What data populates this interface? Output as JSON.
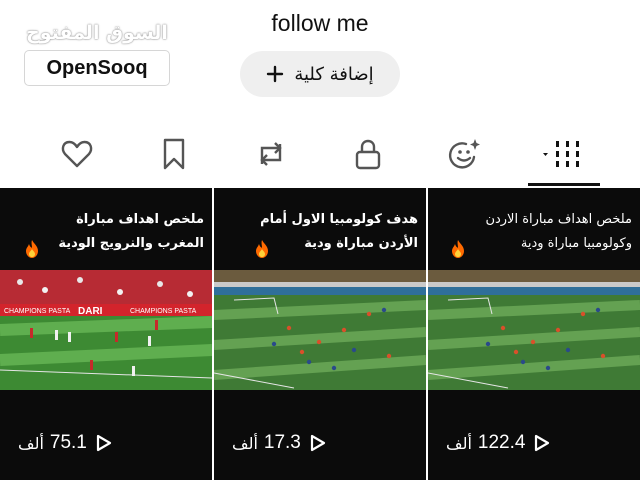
{
  "profile": {
    "bio": "follow me",
    "add_button_label": "إضافة كلية"
  },
  "watermark": {
    "arabic": "السوق المفتوح",
    "latin": "OpenSooq"
  },
  "tabs": [
    {
      "name": "reels-grid-tab",
      "icon": "reels-grid-icon",
      "active": true
    },
    {
      "name": "collab-tab",
      "icon": "smiley-sparkle-icon"
    },
    {
      "name": "private-tab",
      "icon": "lock-icon"
    },
    {
      "name": "reposts-tab",
      "icon": "repost-icon"
    },
    {
      "name": "saved-tab",
      "icon": "bookmark-icon"
    },
    {
      "name": "liked-tab",
      "icon": "heart-icon"
    }
  ],
  "reels": [
    {
      "title": "ملخص اهداف مباراة الاردن\nوكولومبيا مباراة ودية",
      "views": "122.4",
      "views_unit": "ألف",
      "scene": "stadium-green-pitch"
    },
    {
      "title": "هدف كولومبيا الاول أمام\nالأردن مباراة ودية",
      "views": "17.3",
      "views_unit": "ألف",
      "scene": "stadium-green-pitch"
    },
    {
      "title": "ملخص اهداف مباراة\nالمغرب والنرويج الودية",
      "views": "75.1",
      "views_unit": "ألف",
      "scene": "stadium-red-stands",
      "banner_left": "CHAMPIONS PASTA",
      "banner_mid": "DARI",
      "banner_right": "CHAMPIONS PASTA"
    }
  ],
  "colors": {
    "tile_background": "#0b0b0b",
    "pitch_green": "#3f7a35",
    "pill_background": "#efefef"
  }
}
